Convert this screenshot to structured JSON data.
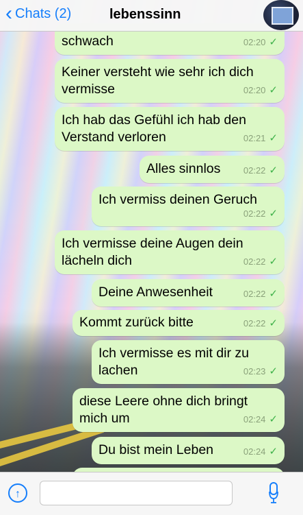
{
  "header": {
    "back_label": "Chats (2)",
    "contact_name": "lebenssinn"
  },
  "messages": [
    {
      "text": "schwach",
      "time": "02:20"
    },
    {
      "text": "Keiner versteht wie sehr ich dich vermisse",
      "time": "02:20"
    },
    {
      "text": "Ich hab das Gefühl ich hab den Verstand verloren",
      "time": "02:21"
    },
    {
      "text": "Alles sinnlos",
      "time": "02:22"
    },
    {
      "text": "Ich vermiss deinen Geruch",
      "time": "02:22"
    },
    {
      "text": "Ich vermisse deine Augen dein lächeln dich",
      "time": "02:22"
    },
    {
      "text": "Deine Anwesenheit",
      "time": "02:22"
    },
    {
      "text": "Kommt zurück bitte",
      "time": "02:22"
    },
    {
      "text": "Ich vermisse es mit dir zu lachen",
      "time": "02:23"
    },
    {
      "text": "diese Leere ohne dich bringt mich um",
      "time": "02:24"
    },
    {
      "text": "Du bist mein Leben",
      "time": "02:24"
    }
  ],
  "input": {
    "placeholder": ""
  },
  "icons": {
    "back": "chevron-left-icon",
    "upload": "upload-arrow-icon",
    "mic": "microphone-icon",
    "tick": "check-icon"
  },
  "colors": {
    "accent": "#157efb",
    "bubble": "#dcf8c6",
    "tick": "#3fb24a"
  }
}
